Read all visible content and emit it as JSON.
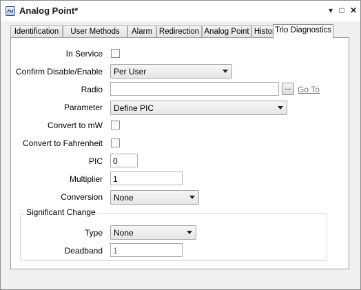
{
  "window": {
    "title": "Analog Point*",
    "minimize_glyph": "▾",
    "maximize_glyph": "□",
    "close_glyph": "✕"
  },
  "tabs": [
    {
      "label": "Identification"
    },
    {
      "label": "User Methods"
    },
    {
      "label": "Alarm"
    },
    {
      "label": "Redirection"
    },
    {
      "label": "Analog Point"
    },
    {
      "label": "Historic"
    },
    {
      "label": "Trio Diagnostics"
    }
  ],
  "form": {
    "in_service": {
      "label": "In Service",
      "checked": false
    },
    "confirm": {
      "label": "Confirm Disable/Enable",
      "value": "Per User"
    },
    "radio": {
      "label": "Radio",
      "value": "",
      "browse_label": "...",
      "goto_label": "Go To"
    },
    "parameter": {
      "label": "Parameter",
      "value": "Define PIC"
    },
    "convert_mw": {
      "label": "Convert to mW",
      "checked": false
    },
    "convert_f": {
      "label": "Convert to Fahrenheit",
      "checked": false
    },
    "pic": {
      "label": "PIC",
      "value": "0"
    },
    "multiplier": {
      "label": "Multiplier",
      "value": "1"
    },
    "conversion": {
      "label": "Conversion",
      "value": "None"
    },
    "significant_change": {
      "title": "Significant Change",
      "type": {
        "label": "Type",
        "value": "None"
      },
      "deadband": {
        "label": "Deadband",
        "value": "1"
      }
    }
  },
  "colors": {
    "link_disabled": "#7a7a7a",
    "active_tab_bg": "#ffffff"
  }
}
